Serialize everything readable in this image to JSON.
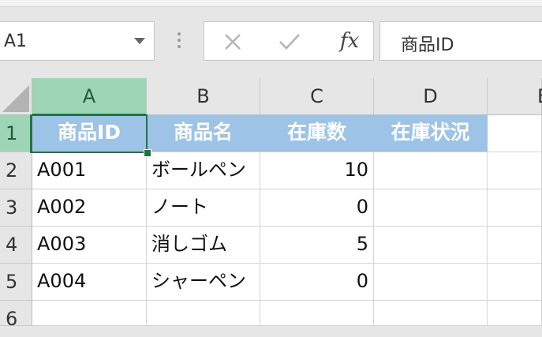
{
  "name_box": {
    "value": "A1"
  },
  "formula": {
    "fx_label": "fx",
    "content": "商品ID"
  },
  "icons": {
    "cancel": "close-icon",
    "enter": "check-icon",
    "insert_function": "fx-icon"
  },
  "columns": [
    "A",
    "B",
    "C",
    "D",
    "E"
  ],
  "rows": [
    "1",
    "2",
    "3",
    "4",
    "5",
    "6"
  ],
  "table": {
    "headers": [
      "商品ID",
      "商品名",
      "在庫数",
      "在庫状況"
    ],
    "data": [
      [
        "A001",
        "ボールペン",
        "10",
        ""
      ],
      [
        "A002",
        "ノート",
        "0",
        ""
      ],
      [
        "A003",
        "消しゴム",
        "5",
        ""
      ],
      [
        "A004",
        "シャーペン",
        "0",
        ""
      ]
    ]
  },
  "colors": {
    "header_fill": "#9dc3e6",
    "selection": "#217346",
    "selected_heading": "#9fd5b7"
  }
}
